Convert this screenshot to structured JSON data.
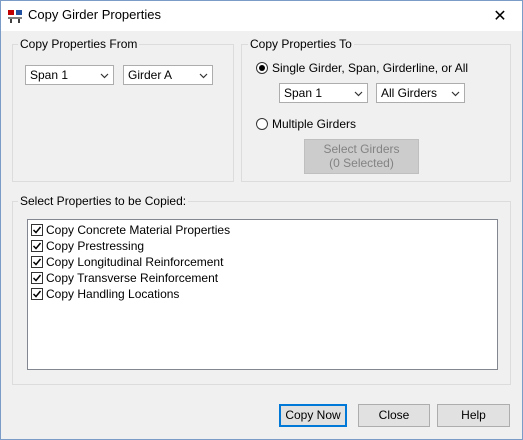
{
  "window": {
    "title": "Copy Girder Properties",
    "close_glyph": "✕",
    "app_icon": "girder-app-icon"
  },
  "copy_from": {
    "label": "Copy Properties From",
    "span_value": "Span 1",
    "girder_value": "Girder A"
  },
  "copy_to": {
    "label": "Copy Properties To",
    "single_option_label": "Single Girder, Span, Girderline, or All",
    "single_selected": true,
    "span_value": "Span 1",
    "girder_value": "All Girders",
    "multiple_option_label": "Multiple Girders",
    "multiple_selected": false,
    "select_button_line1": "Select Girders",
    "select_button_line2": "(0 Selected)"
  },
  "properties": {
    "label": "Select Properties to be Copied:",
    "items": [
      {
        "label": "Copy Concrete Material Properties",
        "checked": true
      },
      {
        "label": "Copy Prestressing",
        "checked": true
      },
      {
        "label": "Copy Longitudinal Reinforcement",
        "checked": true
      },
      {
        "label": "Copy Transverse Reinforcement",
        "checked": true
      },
      {
        "label": "Copy Handling Locations",
        "checked": true
      }
    ]
  },
  "buttons": {
    "copy_now": "Copy Now",
    "close": "Close",
    "help": "Help"
  },
  "colors": {
    "default_button_border": "#0078d7",
    "dialog_background": "#f0f0f0"
  }
}
